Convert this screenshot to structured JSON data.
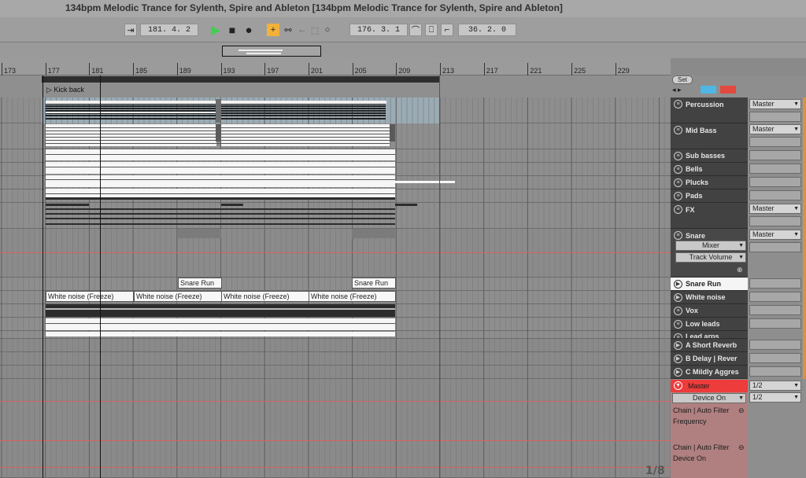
{
  "window": {
    "title": "134bpm Melodic Trance for Sylenth, Spire and Ableton  [134bpm Melodic Trance for Sylenth, Spire and Ableton]"
  },
  "transport": {
    "arrangement_position": "181.  4.  2",
    "loop_start": "176.  3.  1",
    "loop_length": "36.  2.  0"
  },
  "ruler": {
    "bar_labels": [
      "173",
      "177",
      "181",
      "185",
      "189",
      "193",
      "197",
      "201",
      "205",
      "209",
      "213",
      "217",
      "221",
      "225",
      "229"
    ]
  },
  "locator": {
    "name": "Kick back"
  },
  "clips": {
    "snare_run_label": "Snare Run",
    "white_noise_label": "White noise (Freeze)"
  },
  "side": {
    "set_label": "Set"
  },
  "tracks": [
    {
      "name": "Percussion",
      "output": "Master"
    },
    {
      "name": "Mid Bass",
      "output": "Master"
    },
    {
      "name": "Sub basses",
      "output": ""
    },
    {
      "name": "Bells",
      "output": ""
    },
    {
      "name": "Plucks",
      "output": ""
    },
    {
      "name": "Pads",
      "output": ""
    },
    {
      "name": "FX",
      "output": "Master"
    },
    {
      "name": "Snare",
      "output": "Master"
    },
    {
      "name": "Snare Run",
      "output": ""
    },
    {
      "name": "White noise",
      "output": ""
    },
    {
      "name": "Vox",
      "output": ""
    },
    {
      "name": "Low leads",
      "output": ""
    },
    {
      "name": "Lead arps",
      "output": ""
    }
  ],
  "snare_automation": {
    "device": "Mixer",
    "parameter": "Track Volume"
  },
  "returns": [
    {
      "name": "A Short Reverb"
    },
    {
      "name": "B Delay | Rever"
    },
    {
      "name": "C Mildly Aggres"
    }
  ],
  "master": {
    "name": "Master",
    "device_dropdown": "Device On",
    "ratio_1": "1/2",
    "ratio_2": "1/2",
    "lane1_line1": "Chain | Auto Filter",
    "lane1_line2": "Frequency",
    "lane2_line1": "Chain | Auto Filter",
    "lane2_line2": "Device On"
  },
  "pager": "1/8",
  "colors": {
    "master_red": "#ee3b3b",
    "selection": "#9aabb4",
    "play_green": "#3fd14d",
    "draw_orange": "#f2b13a",
    "lock_red": "#e34a3f",
    "view_blue": "#4fb7e6"
  }
}
